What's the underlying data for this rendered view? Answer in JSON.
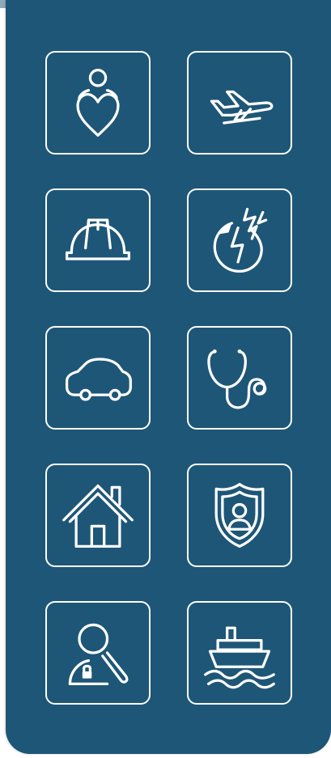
{
  "theme": {
    "panel_color": "#1e5677",
    "icon_color": "#ffffff",
    "background": "#ffffff"
  },
  "categories": [
    {
      "name": "life",
      "icon": "person-heart-icon"
    },
    {
      "name": "travel",
      "icon": "airplane-icon"
    },
    {
      "name": "workers",
      "icon": "hard-hat-icon"
    },
    {
      "name": "accident",
      "icon": "lightning-strike-icon"
    },
    {
      "name": "auto",
      "icon": "car-icon"
    },
    {
      "name": "health",
      "icon": "stethoscope-icon"
    },
    {
      "name": "home",
      "icon": "house-icon"
    },
    {
      "name": "protection",
      "icon": "shield-person-icon"
    },
    {
      "name": "identity",
      "icon": "person-lock-search-icon"
    },
    {
      "name": "marine",
      "icon": "ship-icon"
    }
  ]
}
